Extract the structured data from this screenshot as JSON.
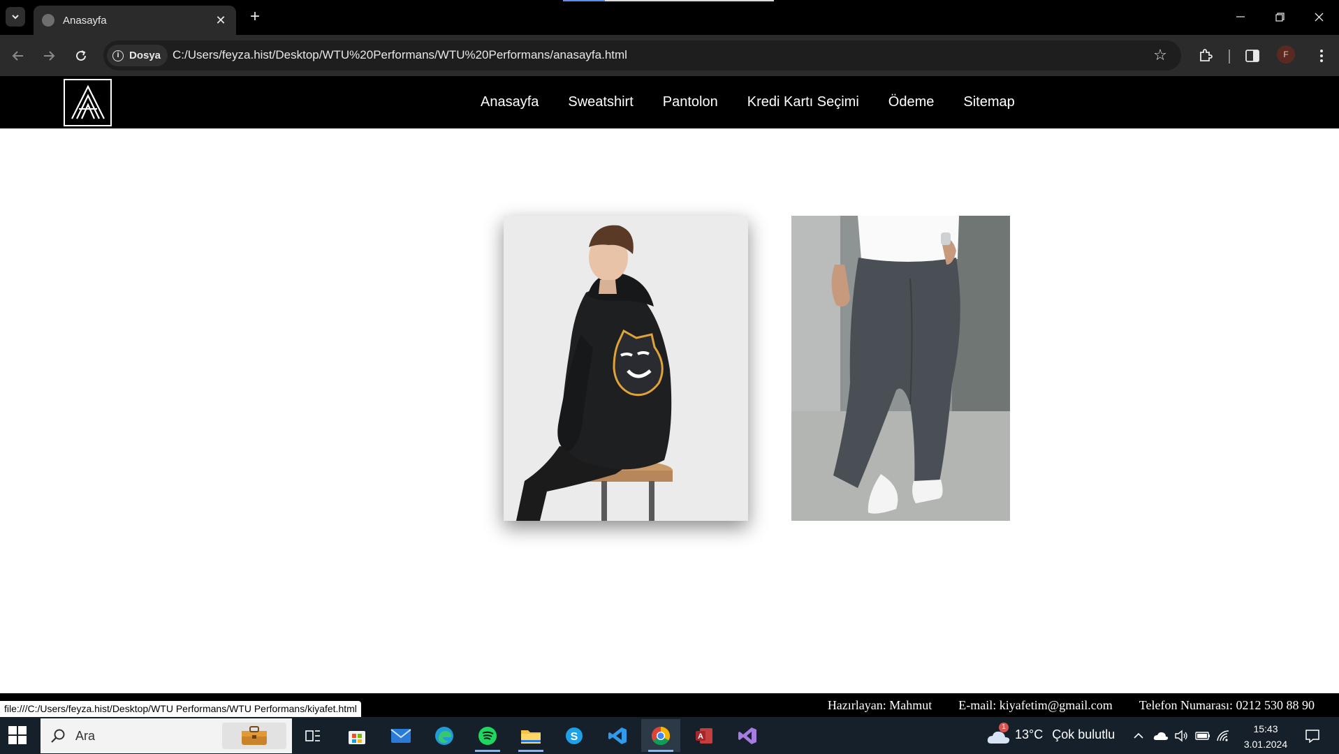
{
  "browser": {
    "tab_title": "Anasayfa",
    "site_chip_label": "Dosya",
    "url": "C:/Users/feyza.hist/Desktop/WTU%20Performans/WTU%20Performans/anasayfa.html",
    "profile_initial": "F"
  },
  "site": {
    "nav": {
      "items": [
        {
          "label": "Anasayfa"
        },
        {
          "label": "Sweatshirt"
        },
        {
          "label": "Pantolon"
        },
        {
          "label": "Kredi Kartı Seçimi"
        },
        {
          "label": "Ödeme"
        },
        {
          "label": "Sitemap"
        }
      ]
    },
    "footer": {
      "prepared_by": "Hazırlayan: Mahmut",
      "email": "E-mail: kiyafetim@gmail.com",
      "phone": "Telefon Numarası: 0212 530 88 90"
    }
  },
  "status_bar": {
    "link_url": "file:///C:/Users/feyza.hist/Desktop/WTU Performans/WTU Performans/kiyafet.html"
  },
  "taskbar": {
    "search_placeholder": "Ara",
    "weather": {
      "temperature": "13°C",
      "condition": "Çok bulutlu",
      "alert_count": "1"
    },
    "clock": {
      "time": "15:43",
      "date": "3.01.2024"
    }
  },
  "colors": {
    "site_header_bg": "#000000",
    "browser_toolbar_bg": "#2b2b2b",
    "taskbar_bg": "#15202b"
  }
}
